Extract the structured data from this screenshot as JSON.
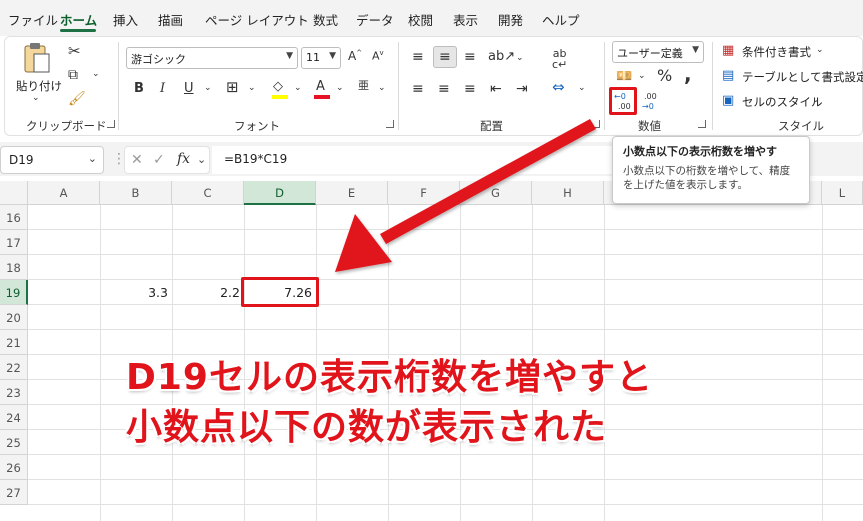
{
  "menu": {
    "items": [
      "ファイル",
      "ホーム",
      "挿入",
      "描画",
      "ページ レイアウト",
      "数式",
      "データ",
      "校閲",
      "表示",
      "開発",
      "ヘルプ"
    ],
    "active": "ホーム"
  },
  "ribbon": {
    "clipboard": {
      "paste_label": "貼り付け",
      "group_label": "クリップボード"
    },
    "font": {
      "font_name": "游ゴシック",
      "font_size": "11",
      "group_label": "フォント",
      "bold": "B",
      "italic": "I",
      "underline": "U"
    },
    "alignment": {
      "group_label": "配置"
    },
    "number": {
      "format": "ユーザー定義",
      "percent": "%",
      "comma": ",",
      "group_label": "数値",
      "increase_decimal": "←0 .00",
      "decrease_decimal": ".00 →0"
    },
    "styles": {
      "conditional": "条件付き書式",
      "table": "テーブルとして書式設定",
      "cell_styles": "セルのスタイル",
      "group_label": "スタイル"
    }
  },
  "formula_bar": {
    "name_box": "D19",
    "fx": "fx",
    "formula": "=B19*C19"
  },
  "tooltip": {
    "title": "小数点以下の表示桁数を増やす",
    "description": "小数点以下の桁数を増やして、精度を上げた値を表示します。"
  },
  "grid": {
    "columns": [
      "A",
      "B",
      "C",
      "D",
      "E",
      "F",
      "G",
      "H",
      "L"
    ],
    "rows": [
      "16",
      "17",
      "18",
      "19",
      "20",
      "21",
      "22",
      "23",
      "24",
      "25",
      "26",
      "27"
    ],
    "cells": {
      "B19": "3.3",
      "C19": "2.2",
      "D19": "7.26"
    }
  },
  "annotation": {
    "line1": "D19セルの表示桁数を増やすと",
    "line2": "小数点以下の数が表示された",
    "color": "#e0141a"
  }
}
